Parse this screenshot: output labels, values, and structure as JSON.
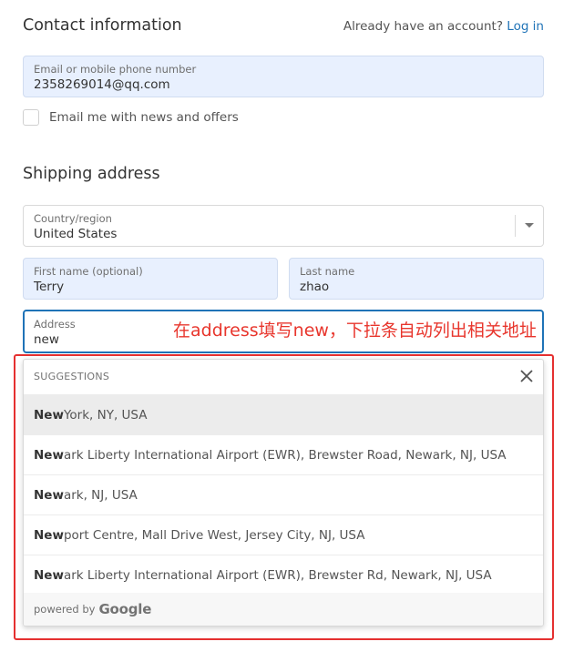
{
  "contact": {
    "title": "Contact information",
    "have_account_text": "Already have an account?",
    "login_link": "Log in",
    "email_label": "Email or mobile phone number",
    "email_value": "2358269014@qq.com",
    "newsletter_label": "Email me with news and offers",
    "newsletter_checked": false
  },
  "shipping": {
    "title": "Shipping address",
    "country_label": "Country/region",
    "country_value": "United States",
    "first_name_label": "First name (optional)",
    "first_name_value": "Terry",
    "last_name_label": "Last name",
    "last_name_value": "zhao",
    "address_label": "Address",
    "address_value": "new"
  },
  "annotation": "在address填写new，下拉条自动列出相关地址",
  "suggestions": {
    "header": "SUGGESTIONS",
    "items": [
      {
        "match": "New",
        "rest": " York, NY, USA"
      },
      {
        "match": "New",
        "rest": "ark Liberty International Airport (EWR), Brewster Road, Newark, NJ, USA"
      },
      {
        "match": "New",
        "rest": "ark, NJ, USA"
      },
      {
        "match": "New",
        "rest": "port Centre, Mall Drive West, Jersey City, NJ, USA"
      },
      {
        "match": "New",
        "rest": "ark Liberty International Airport (EWR), Brewster Rd, Newark, NJ, USA"
      }
    ],
    "powered_by": "powered by",
    "provider": "Google"
  },
  "colors": {
    "link": "#1f73b7",
    "autofill_bg": "#e8f0fe",
    "focus_border": "#1f73b7",
    "annotation": "#e8362d",
    "highlight_row": "#ececec"
  }
}
